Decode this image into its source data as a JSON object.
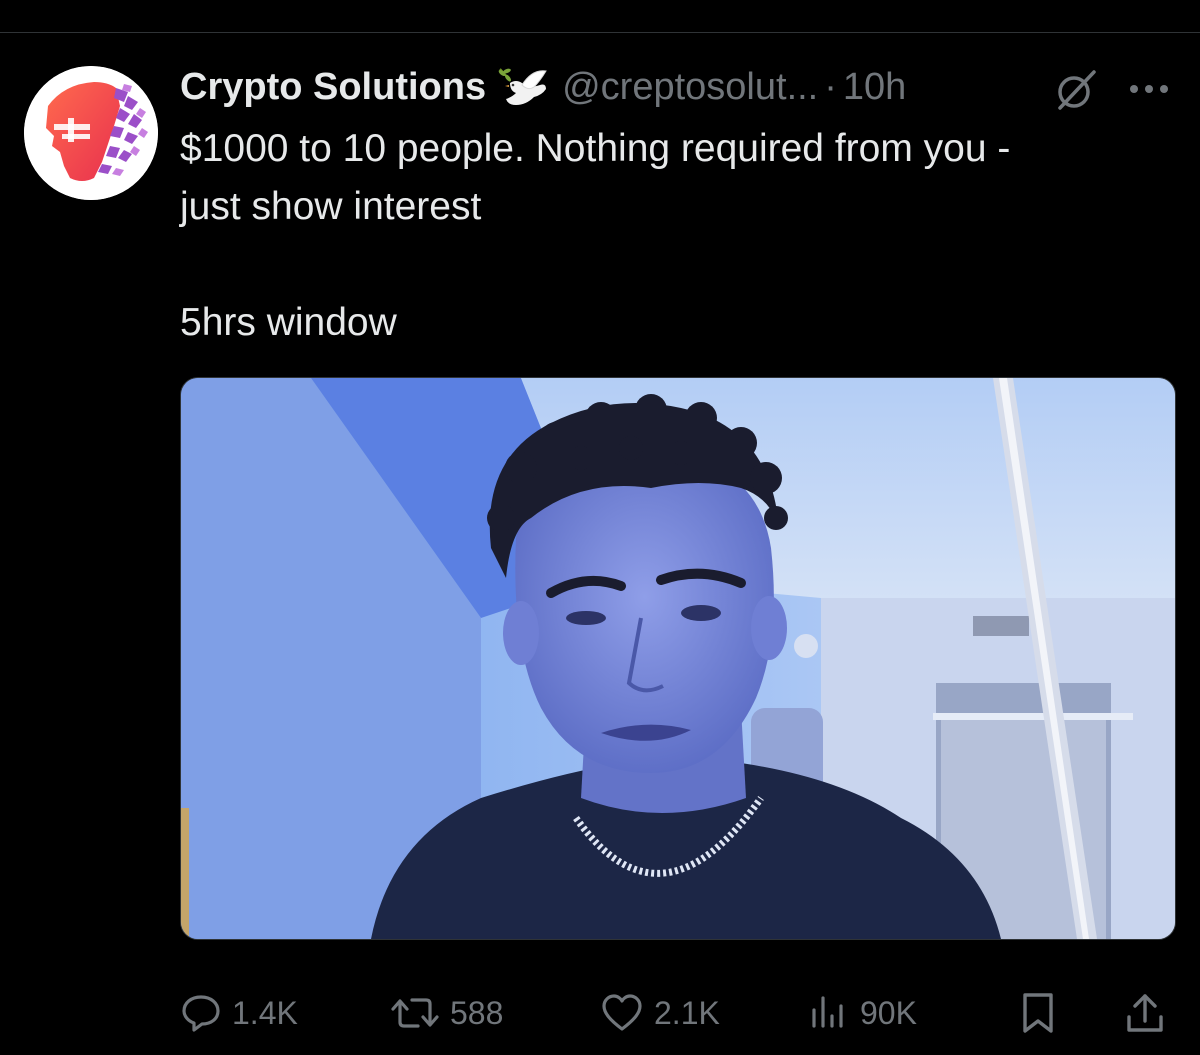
{
  "post": {
    "author": {
      "display_name": "Crypto Solutions",
      "handle": "@creptosolut...",
      "avatar_icon": "red-purple-mosaic-head-logo"
    },
    "separator": "·",
    "timestamp": "10h",
    "text_lines": [
      "$1000 to 10 people. Nothing required from you -",
      "just show interest",
      "5hrs window"
    ],
    "media": {
      "type": "video",
      "description_icon": "video-thumbnail"
    },
    "actions": {
      "replies": "1.4K",
      "reposts": "588",
      "likes": "2.1K",
      "views": "90K"
    }
  },
  "colors": {
    "background": "#000000",
    "text_primary": "#e7e9ea",
    "text_secondary": "#71767b",
    "divider": "#2f3336"
  }
}
